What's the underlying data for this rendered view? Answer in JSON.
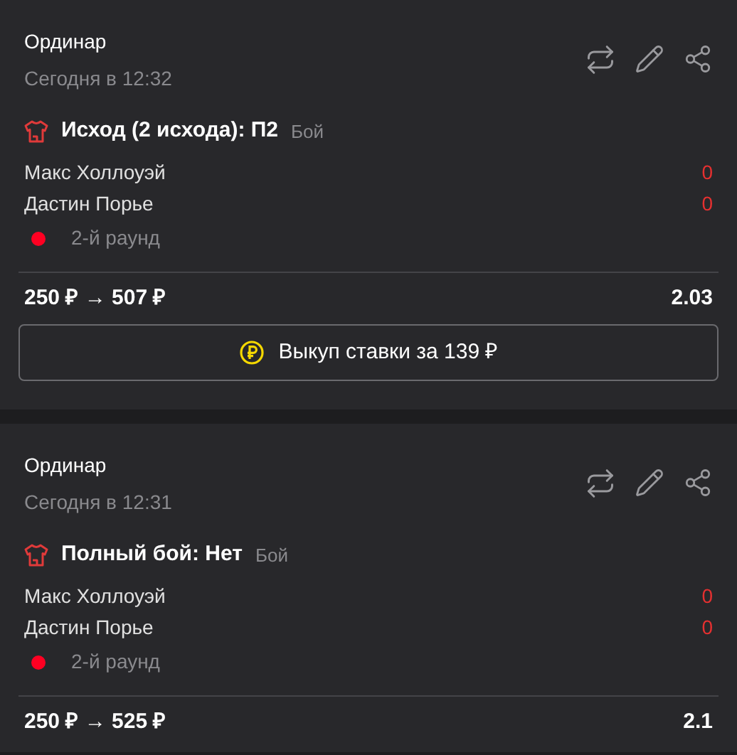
{
  "bets": [
    {
      "type": "Ординар",
      "date": "Сегодня в 12:32",
      "outcome": "Исход (2 исхода): П2",
      "market": "Бой",
      "participants": [
        {
          "name": "Макс Холлоуэй",
          "score": "0"
        },
        {
          "name": "Дастин Порье",
          "score": "0"
        }
      ],
      "status": {
        "text": "2-й раунд",
        "color": "#ff0022"
      },
      "amounts": "250 ₽ → 507 ₽",
      "odds": "2.03",
      "cashout": "Выкуп ставки за 139 ₽"
    },
    {
      "type": "Ординар",
      "date": "Сегодня в 12:31",
      "outcome": "Полный бой: Нет",
      "market": "Бой",
      "participants": [
        {
          "name": "Макс Холлоуэй",
          "score": "0"
        },
        {
          "name": "Дастин Порье",
          "score": "0"
        }
      ],
      "status": {
        "text": "2-й раунд",
        "color": "#ff0022"
      },
      "amounts": "250 ₽ → 525 ₽",
      "odds": "2.1"
    }
  ]
}
